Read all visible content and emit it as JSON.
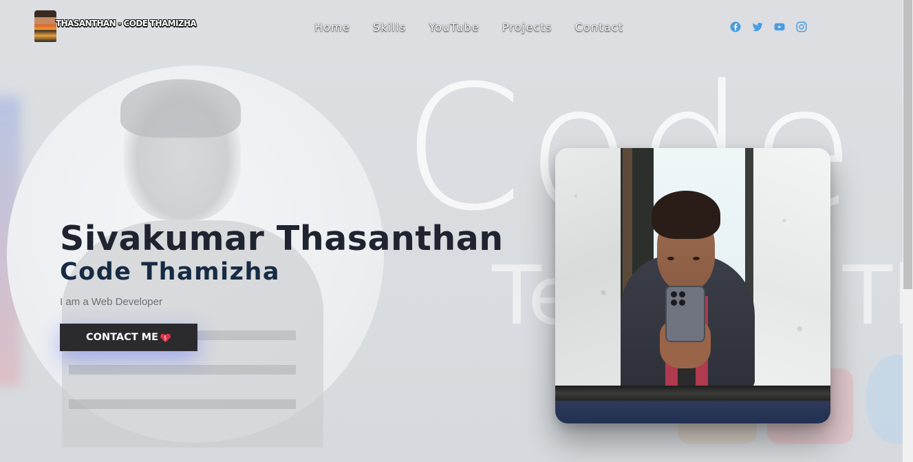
{
  "brand": {
    "name": "THASANTHAN - CODE THAMIZHA"
  },
  "nav": {
    "links": [
      {
        "label": "Home"
      },
      {
        "label": "Skills"
      },
      {
        "label": "YouTube"
      },
      {
        "label": "Projects"
      },
      {
        "label": "Contact"
      }
    ]
  },
  "social": {
    "icons": [
      "facebook-icon",
      "twitter-icon",
      "youtube-icon",
      "instagram-icon"
    ],
    "color": "#4a9de0"
  },
  "hero": {
    "name": "Sivakumar Thasanthan",
    "subtitle": "Code Thamizha",
    "tagline": "I am a Web Developer",
    "cta_label": "CONTACT ME"
  },
  "background": {
    "word_large": "Code Tham",
    "word_small_left": "Te",
    "word_small_right": "Th"
  },
  "colors": {
    "name": "#1f2430",
    "subtitle": "#172b44",
    "button_bg": "#2b2b2e",
    "button_glow": "#5a6eff",
    "heart": "#e0334d"
  }
}
